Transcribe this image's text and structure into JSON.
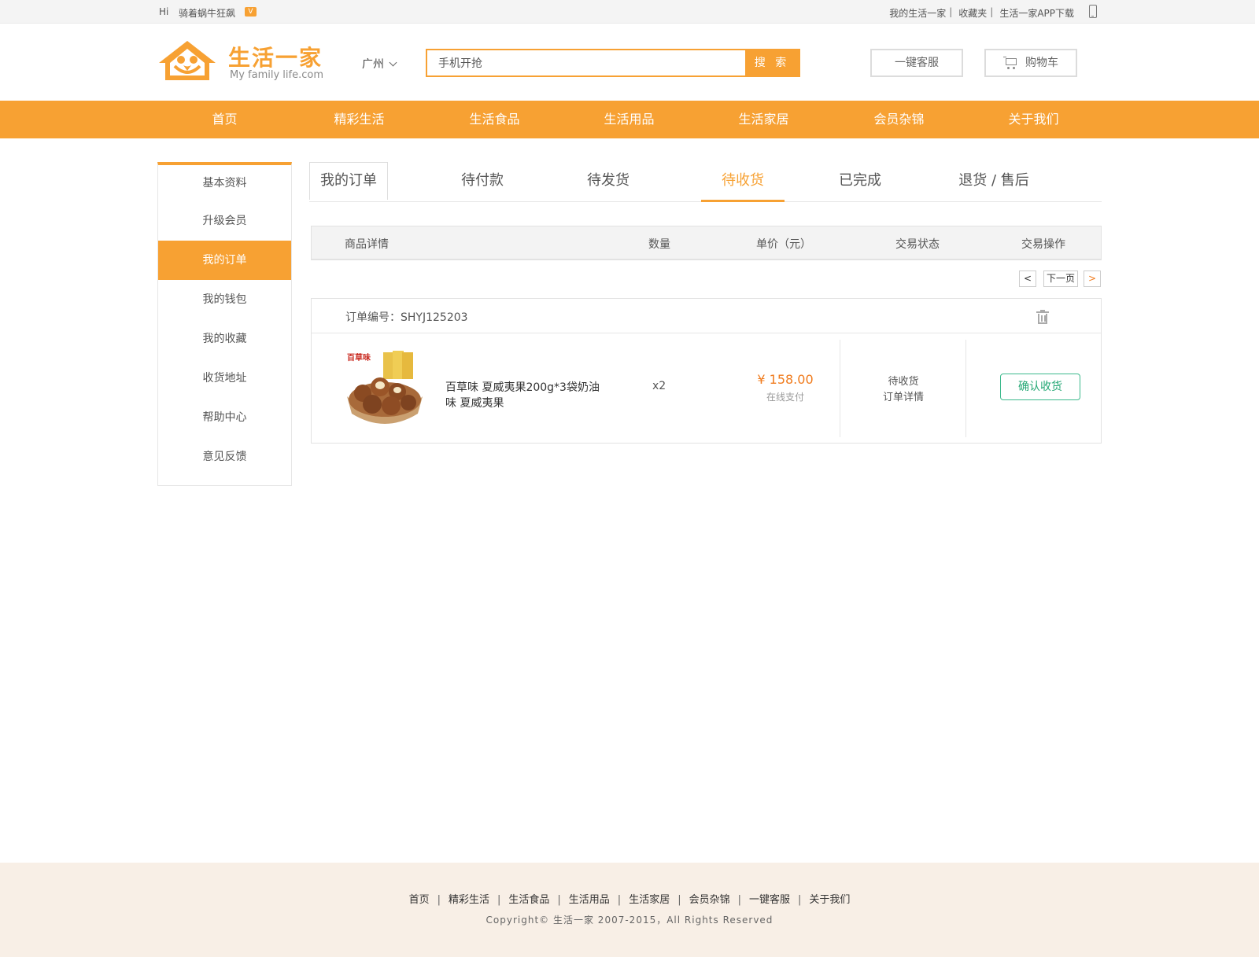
{
  "topbar": {
    "hi": "Hi",
    "username": "骑着蜗牛狂飙",
    "vip_badge": "V",
    "links": [
      "我的生活一家",
      "收藏夹",
      "生活一家APP下载"
    ],
    "separator": "|"
  },
  "header": {
    "logo_title": "生活一家",
    "logo_subtitle": "My family life.com",
    "city": "广州",
    "search_value": "手机开抢",
    "search_button": "搜 索",
    "service_button": "一键客服",
    "cart_button": "购物车"
  },
  "nav": [
    "首页",
    "精彩生活",
    "生活食品",
    "生活用品",
    "生活家居",
    "会员杂锦",
    "关于我们"
  ],
  "sidebar": [
    "基本资料",
    "升级会员",
    "我的订单",
    "我的钱包",
    "我的收藏",
    "收货地址",
    "帮助中心",
    "意见反馈"
  ],
  "sidebar_active": "我的订单",
  "tabs": [
    "我的订单",
    "待付款",
    "待发货",
    "待收货",
    "已完成",
    "退货 / 售后"
  ],
  "tab_active": "待收货",
  "table_header": {
    "product": "商品详情",
    "quantity": "数量",
    "price": "单价（元）",
    "status": "交易状态",
    "action": "交易操作"
  },
  "pager": {
    "prev": "<",
    "next_label": "下一页",
    "next": ">"
  },
  "order": {
    "number": "订单编号：SHYJ125203",
    "product_name": "百草味 夏威夷果200g*3袋奶油味  夏威夷果",
    "product_brand_text": "百草味",
    "quantity": "x2",
    "price": "¥ 158.00",
    "payment": "在线支付",
    "status": "待收货",
    "detail_link": "订单详情",
    "confirm_button": "确认收货"
  },
  "footer": {
    "links": [
      "首页",
      "精彩生活",
      "生活食品",
      "生活用品",
      "生活家居",
      "会员杂锦",
      "一键客服",
      "关于我们"
    ],
    "separator": "|",
    "copyright": "Copyright© 生活一家 2007-2015，All Rights Reserved"
  },
  "colors": {
    "accent": "#f7a133",
    "price": "#f07b1d",
    "confirm": "#3cb98c",
    "footer_bg": "#f8efe6"
  }
}
